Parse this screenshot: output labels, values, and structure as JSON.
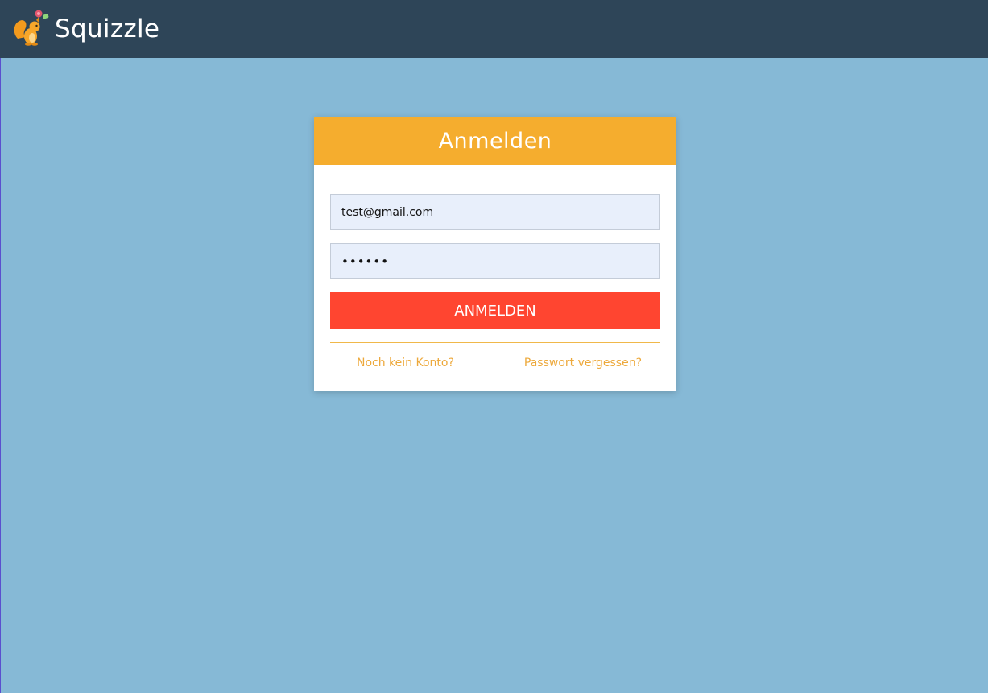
{
  "app": {
    "name": "Squizzle",
    "logo_icon": "squirrel-icon"
  },
  "login": {
    "title": "Anmelden",
    "email_value": "test@gmail.com",
    "password_value": "123456",
    "submit_label": "ANMELDEN",
    "register_link": "Noch kein Konto?",
    "forgot_link": "Passwort vergessen?"
  },
  "colors": {
    "topbar": "#2e4558",
    "background": "#86b9d6",
    "header_accent": "#f5ad2e",
    "button": "#ff4530",
    "link": "#eda93c"
  }
}
